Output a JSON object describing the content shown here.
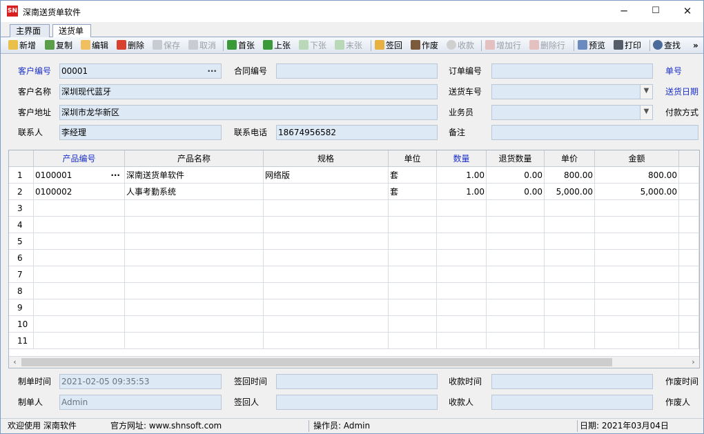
{
  "window": {
    "logo": "SN",
    "title": "深南送货单软件",
    "min": "─",
    "max": "☐",
    "close": "✕"
  },
  "tabs": [
    {
      "label": "主界面"
    },
    {
      "label": "送货单"
    }
  ],
  "toolbar": {
    "new": "新增",
    "copy": "复制",
    "edit": "编辑",
    "delete": "删除",
    "save": "保存",
    "cancel": "取消",
    "first": "首张",
    "prev": "上张",
    "next": "下张",
    "last": "末张",
    "sign": "签回",
    "void": "作废",
    "collect": "收款",
    "add_row": "增加行",
    "del_row": "删除行",
    "preview": "预览",
    "print": "打印",
    "find": "查找",
    "more": "»"
  },
  "form": {
    "customer_no_label": "客户编号",
    "customer_no": "00001",
    "contract_no_label": "合同编号",
    "contract_no": "",
    "order_no_label": "订单编号",
    "order_no": "",
    "doc_no_label": "单号",
    "customer_name_label": "客户名称",
    "customer_name": "深圳现代蓝牙",
    "vehicle_label": "送货车号",
    "vehicle": "",
    "delivery_date_label": "送货日期",
    "customer_addr_label": "客户地址",
    "customer_addr": "深圳市龙华新区",
    "salesman_label": "业务员",
    "salesman": "",
    "payment_label": "付款方式",
    "contact_label": "联系人",
    "contact": "李经理",
    "phone_label": "联系电话",
    "phone": "18674956582",
    "remark_label": "备注",
    "remark": ""
  },
  "grid": {
    "columns": [
      "产品编号",
      "产品名称",
      "规格",
      "单位",
      "数量",
      "退货数量",
      "单价",
      "金额"
    ],
    "rows": [
      {
        "no": "1",
        "code": "0100001",
        "name": "深南送货单软件",
        "spec": "网络版",
        "unit": "套",
        "qty": "1.00",
        "ret": "0.00",
        "price": "800.00",
        "amount": "800.00"
      },
      {
        "no": "2",
        "code": "0100002",
        "name": "人事考勤系统",
        "spec": "",
        "unit": "套",
        "qty": "1.00",
        "ret": "0.00",
        "price": "5,000.00",
        "amount": "5,000.00"
      },
      {
        "no": "3",
        "code": "",
        "name": "",
        "spec": "",
        "unit": "",
        "qty": "",
        "ret": "",
        "price": "",
        "amount": ""
      },
      {
        "no": "4",
        "code": "",
        "name": "",
        "spec": "",
        "unit": "",
        "qty": "",
        "ret": "",
        "price": "",
        "amount": ""
      },
      {
        "no": "5",
        "code": "",
        "name": "",
        "spec": "",
        "unit": "",
        "qty": "",
        "ret": "",
        "price": "",
        "amount": ""
      },
      {
        "no": "6",
        "code": "",
        "name": "",
        "spec": "",
        "unit": "",
        "qty": "",
        "ret": "",
        "price": "",
        "amount": ""
      },
      {
        "no": "7",
        "code": "",
        "name": "",
        "spec": "",
        "unit": "",
        "qty": "",
        "ret": "",
        "price": "",
        "amount": ""
      },
      {
        "no": "8",
        "code": "",
        "name": "",
        "spec": "",
        "unit": "",
        "qty": "",
        "ret": "",
        "price": "",
        "amount": ""
      },
      {
        "no": "9",
        "code": "",
        "name": "",
        "spec": "",
        "unit": "",
        "qty": "",
        "ret": "",
        "price": "",
        "amount": ""
      },
      {
        "no": "10",
        "code": "",
        "name": "",
        "spec": "",
        "unit": "",
        "qty": "",
        "ret": "",
        "price": "",
        "amount": ""
      },
      {
        "no": "11",
        "code": "",
        "name": "",
        "spec": "",
        "unit": "",
        "qty": "",
        "ret": "",
        "price": "",
        "amount": ""
      }
    ],
    "scroll_left": "‹",
    "scroll_right": "›"
  },
  "footer": {
    "created_time_label": "制单时间",
    "created_time": "2021-02-05 09:35:53",
    "signed_time_label": "签回时间",
    "signed_time": "",
    "collect_time_label": "收款时间",
    "collect_time": "",
    "void_time_label": "作废时间",
    "creator_label": "制单人",
    "creator": "Admin",
    "signer_label": "签回人",
    "signer": "",
    "collector_label": "收款人",
    "collector": "",
    "voider_label": "作废人"
  },
  "status": {
    "welcome": "欢迎使用 深南软件",
    "website": "官方网址: www.shnsoft.com",
    "operator": "操作员: Admin",
    "date": "日期: 2021年03月04日"
  },
  "colors": {
    "accent_blue": "#1b30c8",
    "field_bg": "#dde9f5",
    "logo_red": "#d92020"
  }
}
